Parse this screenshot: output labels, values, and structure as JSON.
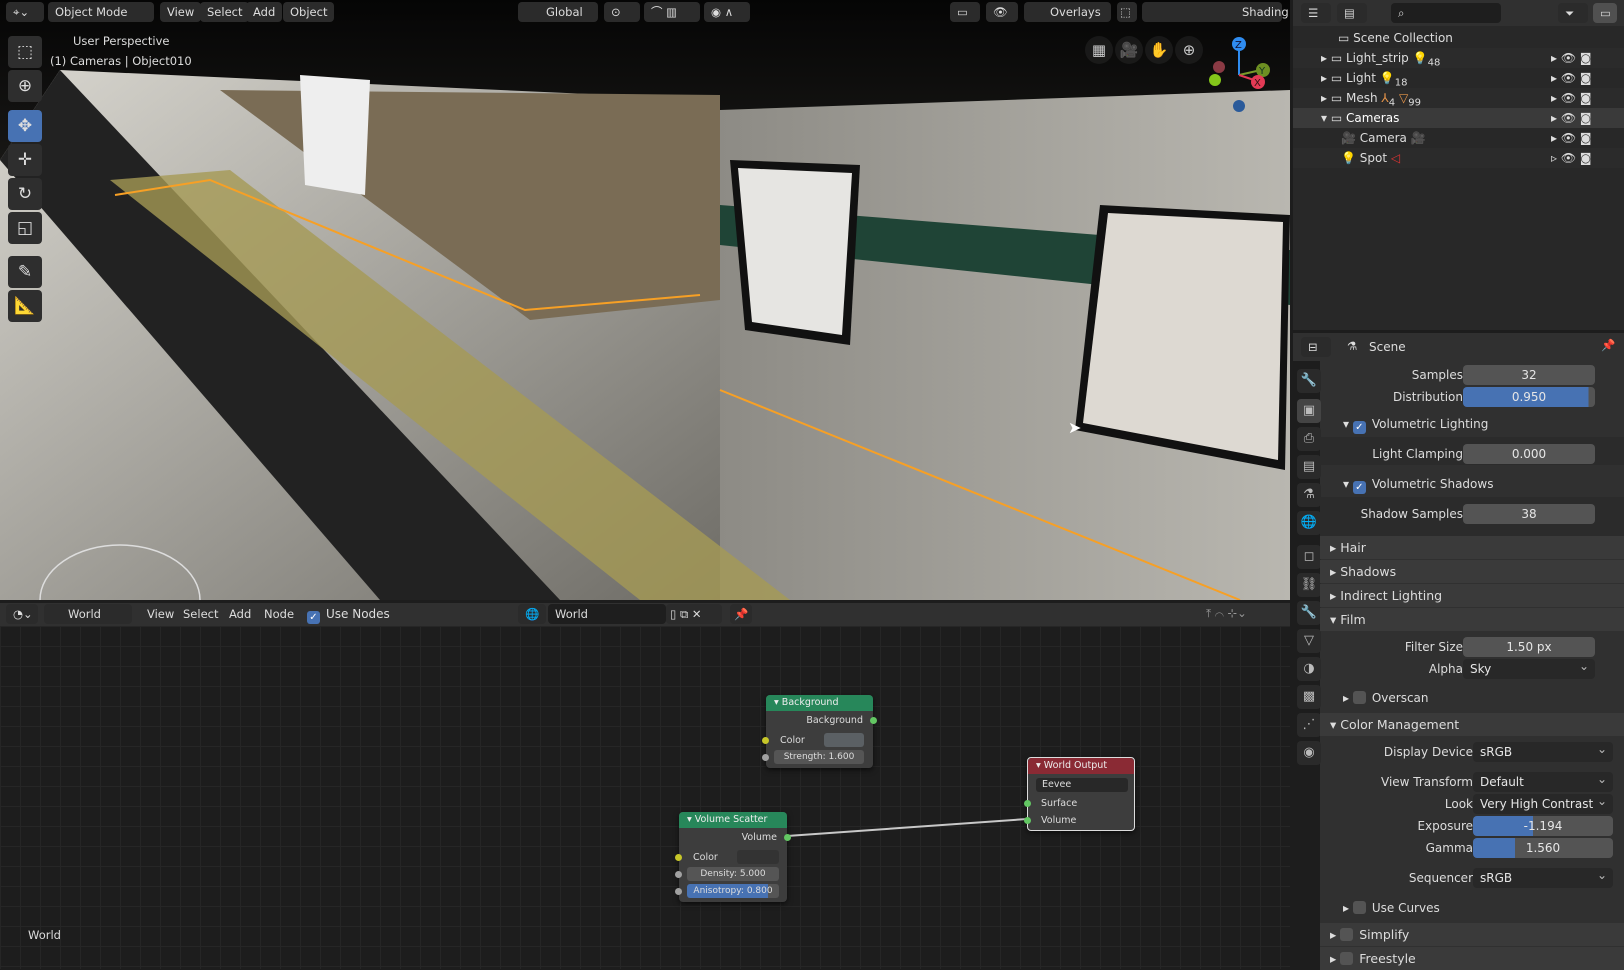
{
  "viewport": {
    "header": {
      "mode": "Object Mode",
      "menus": [
        "View",
        "Select",
        "Add",
        "Object"
      ],
      "orientation": "Global",
      "overlays": "Overlays",
      "shading": "Shading"
    },
    "info_line1": "User Perspective",
    "info_line2": "(1) Cameras | Object010",
    "gizmo": {
      "z": "Z",
      "y": "Y",
      "x": "X"
    }
  },
  "outliner": {
    "root": "Scene Collection",
    "items": [
      {
        "label": "Light_strip",
        "badge": "48"
      },
      {
        "label": "Light",
        "badge": "18"
      },
      {
        "label": "Mesh",
        "badge": "4",
        "badge2": "99"
      },
      {
        "label": "Cameras"
      },
      {
        "label": "Camera"
      },
      {
        "label": "Spot"
      }
    ]
  },
  "properties": {
    "context": "Scene",
    "samples_label": "Samples",
    "samples": "32",
    "distribution_label": "Distribution",
    "distribution": "0.950",
    "distribution_fraction": 0.95,
    "vol_lighting": "Volumetric Lighting",
    "light_clamping_label": "Light Clamping",
    "light_clamping": "0.000",
    "vol_shadows": "Volumetric Shadows",
    "shadow_samples_label": "Shadow Samples",
    "shadow_samples": "38",
    "panels": [
      "Hair",
      "Shadows",
      "Indirect Lighting",
      "Film"
    ],
    "filter_size_label": "Filter Size",
    "filter_size": "1.50 px",
    "alpha_label": "Alpha",
    "alpha": "Sky",
    "overscan": "Overscan",
    "color_management": "Color Management",
    "display_device_label": "Display Device",
    "display_device": "sRGB",
    "view_transform_label": "View Transform",
    "view_transform": "Default",
    "look_label": "Look",
    "look": "Very High Contrast",
    "exposure_label": "Exposure",
    "exposure": "-1.194",
    "exposure_fraction": 0.43,
    "gamma_label": "Gamma",
    "gamma": "1.560",
    "gamma_fraction": 0.3,
    "sequencer_label": "Sequencer",
    "sequencer": "sRGB",
    "use_curves": "Use Curves",
    "simplify": "Simplify",
    "freestyle": "Freestyle"
  },
  "node_editor": {
    "header": {
      "type": "World",
      "menus": [
        "View",
        "Select",
        "Add",
        "Node"
      ],
      "use_nodes": "Use Nodes",
      "world_name": "World"
    },
    "corner_label": "World",
    "background_node": {
      "title": "Background",
      "output": "Background",
      "color": "Color",
      "strength_label": "Strength:",
      "strength": "1.600"
    },
    "scatter_node": {
      "title": "Volume Scatter",
      "output": "Volume",
      "color": "Color",
      "density_label": "Density:",
      "density": "5.000",
      "anisotropy_label": "Anisotropy:",
      "anisotropy": "0.800"
    },
    "output_node": {
      "title": "World Output",
      "target": "Eevee",
      "surface": "Surface",
      "volume": "Volume"
    }
  }
}
